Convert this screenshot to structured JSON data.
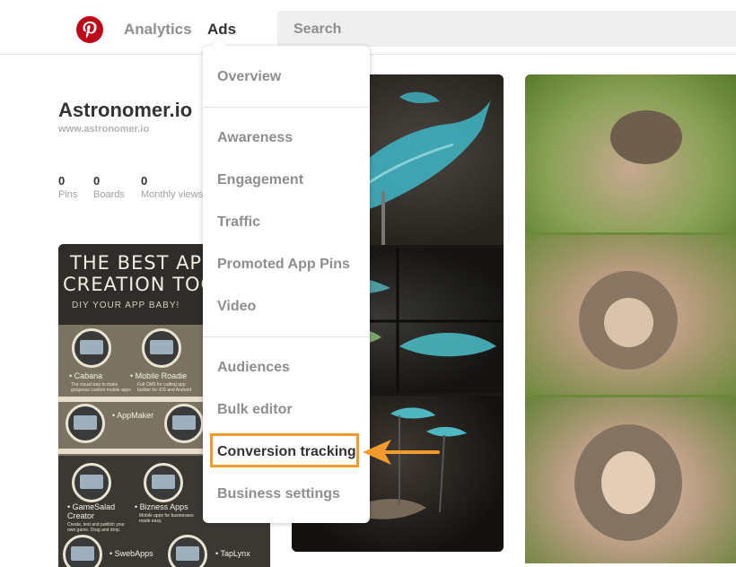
{
  "header": {
    "nav": {
      "analytics": "Analytics",
      "ads": "Ads"
    },
    "search_placeholder": "Search"
  },
  "profile": {
    "name": "Astronomer.io",
    "url": "www.astronomer.io",
    "stats": [
      {
        "value": "0",
        "label": "Pins"
      },
      {
        "value": "0",
        "label": "Boards"
      },
      {
        "value": "0",
        "label": "Monthly views"
      }
    ]
  },
  "infographic": {
    "title_line1": "THE BEST APP",
    "title_line2": "CREATION TOOLS",
    "subtitle": "DIY YOUR APP BABY!",
    "apps": [
      {
        "name": "Cabana",
        "desc": "The visual way to make gorgeous custom mobile apps"
      },
      {
        "name": "Mobile Roadie",
        "desc": "Full CMS for cutting app builder for iOS and Android"
      },
      {
        "name": "AppMaker",
        "desc": ""
      },
      {
        "name": "GameSalad Creator",
        "desc": "Create, test and publish your own game. Drag and drop."
      },
      {
        "name": "Bizness Apps",
        "desc": "Mobile apps for businesses made easy."
      },
      {
        "name": "SwebApps",
        "desc": ""
      },
      {
        "name": "TapLynx",
        "desc": ""
      }
    ]
  },
  "dropdown": {
    "items": [
      {
        "label": "Overview"
      },
      {
        "label": "Awareness"
      },
      {
        "label": "Engagement"
      },
      {
        "label": "Traffic"
      },
      {
        "label": "Promoted App Pins"
      },
      {
        "label": "Video"
      },
      {
        "label": "Audiences"
      },
      {
        "label": "Bulk editor"
      },
      {
        "label": "Conversion tracking"
      },
      {
        "label": "Business settings"
      }
    ],
    "highlighted": "Conversion tracking"
  },
  "colors": {
    "brand": "#bd081c",
    "highlight": "#f39c2d"
  }
}
